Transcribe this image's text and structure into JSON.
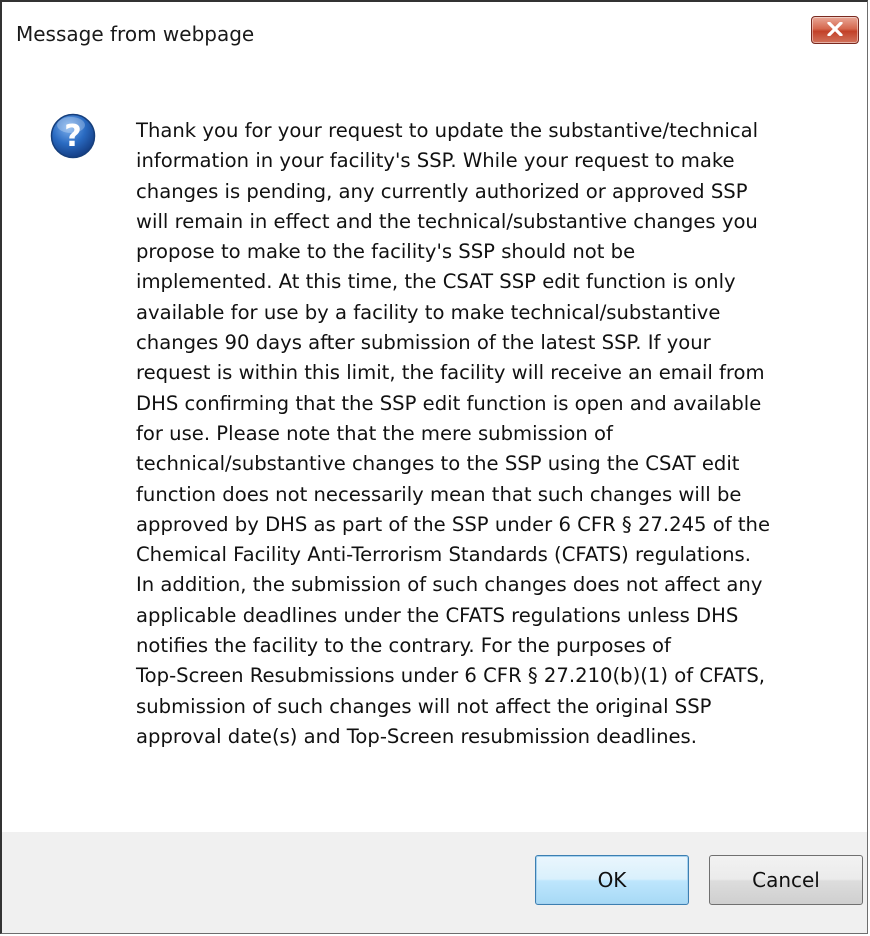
{
  "window": {
    "title": "Message from webpage",
    "close_icon": "close-icon"
  },
  "message": {
    "icon": "question-icon",
    "text": "Thank you for your request to update the substantive/technical\ninformation in your facility's SSP. While your request to make\nchanges is pending, any currently authorized or approved SSP\nwill remain in effect and the technical/substantive changes you\npropose to make to the facility's SSP should not be\nimplemented. At this time, the CSAT SSP edit function is only\navailable for use by a facility to make technical/substantive\nchanges 90 days after submission of the latest SSP. If your\nrequest is within this limit, the facility will receive an email from\nDHS confirming that the SSP edit function is open and available\nfor use.  Please note that the mere submission of\ntechnical/substantive changes to the SSP using the CSAT edit\nfunction does not necessarily mean that such changes will be\napproved by DHS as part of the SSP under 6 CFR § 27.245 of the\nChemical Facility Anti-Terrorism Standards (CFATS) regulations.\nIn addition,  the submission of such changes does not affect any\napplicable deadlines under the CFATS regulations unless DHS\nnotifies the facility to the contrary. For the purposes of\nTop-Screen Resubmissions under 6 CFR § 27.210(b)(1) of CFATS,\nsubmission of such changes will not affect the original SSP\napproval date(s) and Top-Screen resubmission deadlines."
  },
  "buttons": {
    "ok_label": "OK",
    "cancel_label": "Cancel"
  },
  "colors": {
    "close_button": "#c24128",
    "question_icon": "#1f5fae",
    "footer_background": "#f0f0f0",
    "ok_button_accent": "#3c7fb1"
  }
}
